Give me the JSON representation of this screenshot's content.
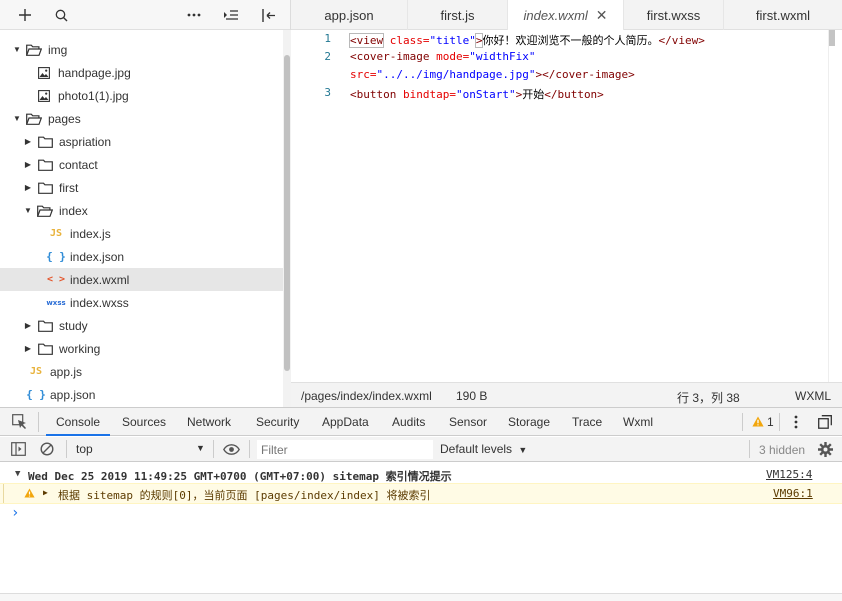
{
  "sidebar": {
    "toolbar": {
      "add_icon": "plus-icon",
      "search_icon": "search-icon",
      "more_icon": "ellipsis-icon",
      "collapse_icon": "outdent-icon",
      "split_icon": "split-icon"
    },
    "tree": [
      {
        "label": "img",
        "type": "folder",
        "open": true,
        "depth": 0
      },
      {
        "label": "handpage.jpg",
        "type": "image",
        "depth": 1
      },
      {
        "label": "photo1(1).jpg",
        "type": "image",
        "depth": 1
      },
      {
        "label": "pages",
        "type": "folder",
        "open": true,
        "depth": 0
      },
      {
        "label": "aspriation",
        "type": "folder",
        "open": false,
        "depth": 1
      },
      {
        "label": "contact",
        "type": "folder",
        "open": false,
        "depth": 1
      },
      {
        "label": "first",
        "type": "folder",
        "open": false,
        "depth": 1
      },
      {
        "label": "index",
        "type": "folder",
        "open": true,
        "depth": 1
      },
      {
        "label": "index.js",
        "type": "js",
        "badge": "JS",
        "depth": 2
      },
      {
        "label": "index.json",
        "type": "json",
        "badge": "{ }",
        "depth": 2
      },
      {
        "label": "index.wxml",
        "type": "wxml",
        "badge": "< >",
        "depth": 2,
        "selected": true
      },
      {
        "label": "index.wxss",
        "type": "wxss",
        "badge": "wxss",
        "depth": 2
      },
      {
        "label": "study",
        "type": "folder",
        "open": false,
        "depth": 1
      },
      {
        "label": "working",
        "type": "folder",
        "open": false,
        "depth": 1
      },
      {
        "label": "app.js",
        "type": "js",
        "badge": "JS",
        "depth": 0
      },
      {
        "label": "app.json",
        "type": "json",
        "badge": "{ }",
        "depth": 0
      }
    ]
  },
  "editor": {
    "tabs": [
      {
        "label": "app.json"
      },
      {
        "label": "first.js"
      },
      {
        "label": "index.wxml",
        "active": true,
        "close": "✕"
      },
      {
        "label": "first.wxss"
      },
      {
        "label": "first.wxml"
      }
    ],
    "line_numbers": [
      "1",
      "2",
      "3"
    ],
    "code": {
      "l1": {
        "open": "<view",
        "attr": " class=",
        "val": "\"title\"",
        "close": ">",
        "text": "你好！欢迎浏览不一般的个人简历。",
        "end": "</view>"
      },
      "l2a": {
        "open": "<cover-image",
        "attr": " mode=",
        "val": "\"widthFix\""
      },
      "l2b": {
        "attr": "src=",
        "val": "\"../../img/handpage.jpg\"",
        "close": "></cover-image>"
      },
      "l3": {
        "open": "<button",
        "attr": " bindtap=",
        "val": "\"onStart\"",
        "close": ">",
        "text": "开始",
        "end": "</button>"
      }
    },
    "status": {
      "path": "/pages/index/index.wxml",
      "size": "190 B",
      "position": "行 3，列 38",
      "language": "WXML"
    }
  },
  "devtools": {
    "tabs": [
      "Console",
      "Sources",
      "Network",
      "Security",
      "AppData",
      "Audits",
      "Sensor",
      "Storage",
      "Trace",
      "Wxml"
    ],
    "active_tab": "Console",
    "warning_count": "1",
    "toolbar": {
      "context": "top",
      "filter_placeholder": "Filter",
      "levels": "Default levels",
      "hidden": "3 hidden"
    },
    "messages": {
      "group_header": "Wed Dec 25 2019 11:49:25 GMT+0700 (GMT+07:00) sitemap 索引情况提示",
      "group_source": "VM125:4",
      "warning_text": "根据 sitemap 的规则[0]，当前页面 [pages/index/index] 将被索引",
      "warning_source": "VM96:1",
      "prompt": "›"
    },
    "colors": {
      "accent": "#1a73e8",
      "warning_bg": "#fffbe5",
      "warning_border": "#fff5c2",
      "warning_icon": "#f2a60c"
    }
  }
}
